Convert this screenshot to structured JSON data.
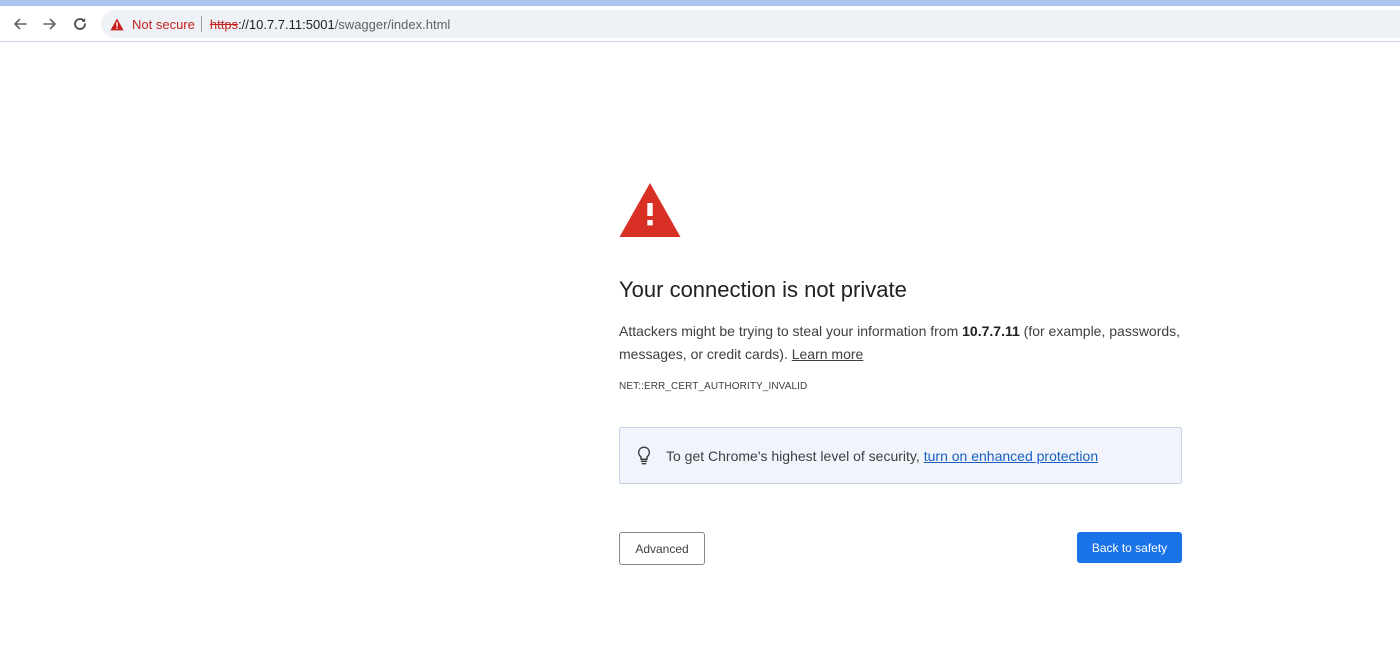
{
  "browser": {
    "security_label": "Not secure",
    "url": {
      "scheme": "https",
      "host": "://10.7.7.11:5001",
      "path": "/swagger/index.html"
    },
    "icons": {
      "back": "arrow-left-icon",
      "forward": "arrow-right-icon",
      "reload": "reload-icon",
      "security": "warning-triangle-icon"
    },
    "colors": {
      "not_secure": "#c5221f",
      "toolbar_bg": "#ffffff",
      "omnibox_bg": "#eef1f5"
    }
  },
  "interstitial": {
    "title": "Your connection is not private",
    "message": {
      "before_host": "Attackers might be trying to steal your information from ",
      "host": "10.7.7.11",
      "after_host": " (for example, passwords, messages, or credit cards). ",
      "learn_more": "Learn more"
    },
    "error_code": "NET::ERR_CERT_AUTHORITY_INVALID",
    "enhanced_protection": {
      "text": "To get Chrome's highest level of security,",
      "link": "turn on enhanced protection",
      "icon": "lightbulb-icon"
    },
    "buttons": {
      "advanced": "Advanced",
      "back_to_safety": "Back to safety"
    },
    "colors": {
      "warning_icon": "#d93025",
      "primary_button": "#1a73e8",
      "link": "#1a5fc4"
    }
  }
}
